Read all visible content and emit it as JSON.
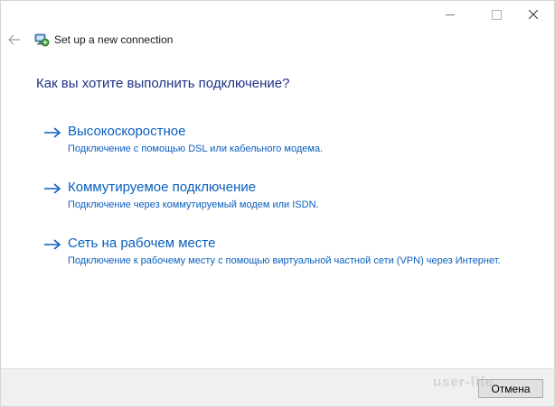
{
  "window": {
    "title": "Set up a new connection",
    "controls": [
      "minimize",
      "maximize",
      "close"
    ]
  },
  "heading": "Как вы хотите выполнить подключение?",
  "options": [
    {
      "title": "Высокоскоростное",
      "description": "Подключение с помощью DSL или кабельного модема."
    },
    {
      "title": "Коммутируемое подключение",
      "description": "Подключение через коммутируемый модем или ISDN."
    },
    {
      "title": "Сеть на рабочем месте",
      "description": "Подключение к рабочему месту с помощью виртуальной частной сети (VPN) через Интернет."
    }
  ],
  "footer": {
    "cancel_label": "Отмена"
  },
  "watermark": "user-life",
  "icons": {
    "back": "back-arrow-icon",
    "app": "network-connection-icon",
    "option_arrow": "right-arrow-icon"
  },
  "colors": {
    "heading": "#1e3287",
    "link": "#0a5fbd",
    "footer_bg": "#f0f0f0"
  }
}
